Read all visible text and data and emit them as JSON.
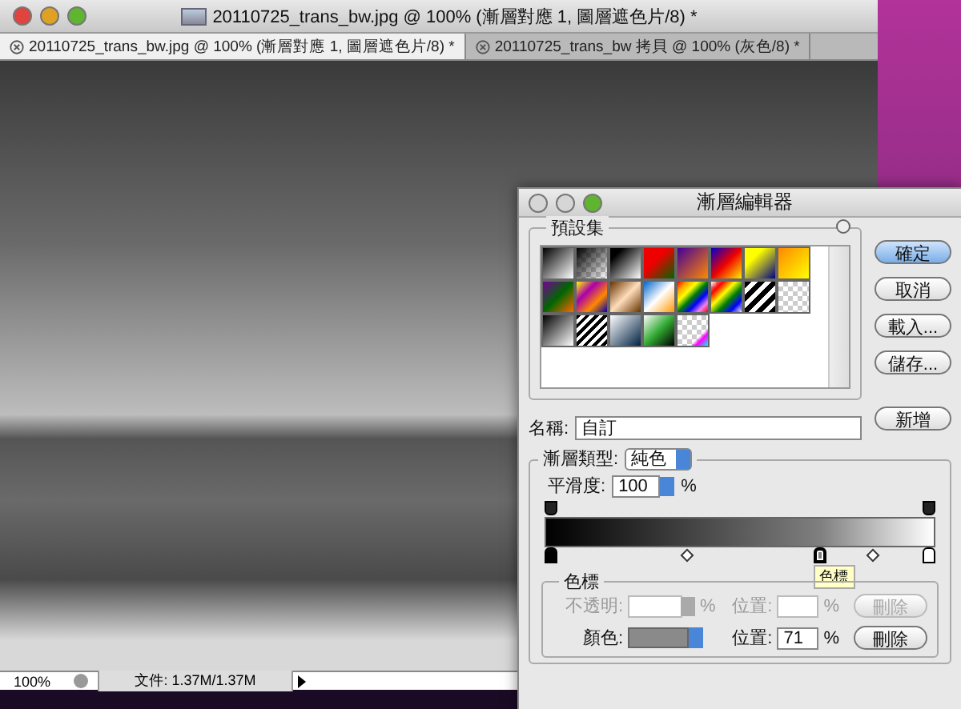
{
  "window": {
    "title": "20110725_trans_bw.jpg @ 100% (漸層對應 1, 圖層遮色片/8) *"
  },
  "tabs": [
    {
      "label": "20110725_trans_bw.jpg @ 100% (漸層對應 1, 圖層遮色片/8) *",
      "selected": true
    },
    {
      "label": "20110725_trans_bw 拷貝 @ 100% (灰色/8) *",
      "selected": false
    }
  ],
  "status_bar": {
    "zoom": "100%",
    "file_info": "文件: 1.37M/1.37M"
  },
  "dialog": {
    "title": "漸層編輯器",
    "presets": {
      "label": "預設集"
    },
    "buttons": [
      {
        "label": "確定",
        "default": true
      },
      {
        "label": "取消",
        "default": false
      },
      {
        "label": "載入...",
        "default": false
      },
      {
        "label": "儲存...",
        "default": false
      }
    ],
    "name": {
      "label": "名稱:",
      "value": "自訂"
    },
    "new_button": "新增",
    "gradient": {
      "type_label": "漸層類型:",
      "type_value": "純色",
      "smoothness_label": "平滑度:",
      "smoothness_value": "100",
      "smoothness_unit": "%",
      "opacity_stops": [
        {
          "level": 0,
          "selected": false
        },
        {
          "level": 1,
          "selected": false
        }
      ],
      "color_stops": [
        {
          "level": 0,
          "color": "#000000",
          "selected": false
        },
        {
          "level": 0.71,
          "color": "#808080",
          "selected": true
        },
        {
          "level": 1,
          "color": "#ffffff",
          "selected": false
        }
      ],
      "midpoints": [
        {
          "level": 0.36
        },
        {
          "level": 0.85
        }
      ],
      "tooltip": "色標"
    },
    "stops": {
      "title": "色標",
      "rows": [
        {
          "kind": "opacity",
          "label": "不透明:",
          "unit": "%",
          "position_label": "位置:",
          "position_value": "",
          "position_unit": "%",
          "delete": "刪除",
          "disabled": true
        },
        {
          "kind": "color",
          "label": "顏色:",
          "color": "#8a8a8a",
          "position_label": "位置:",
          "position_value": "71",
          "position_unit": "%",
          "delete": "刪除",
          "disabled": false
        }
      ]
    }
  }
}
